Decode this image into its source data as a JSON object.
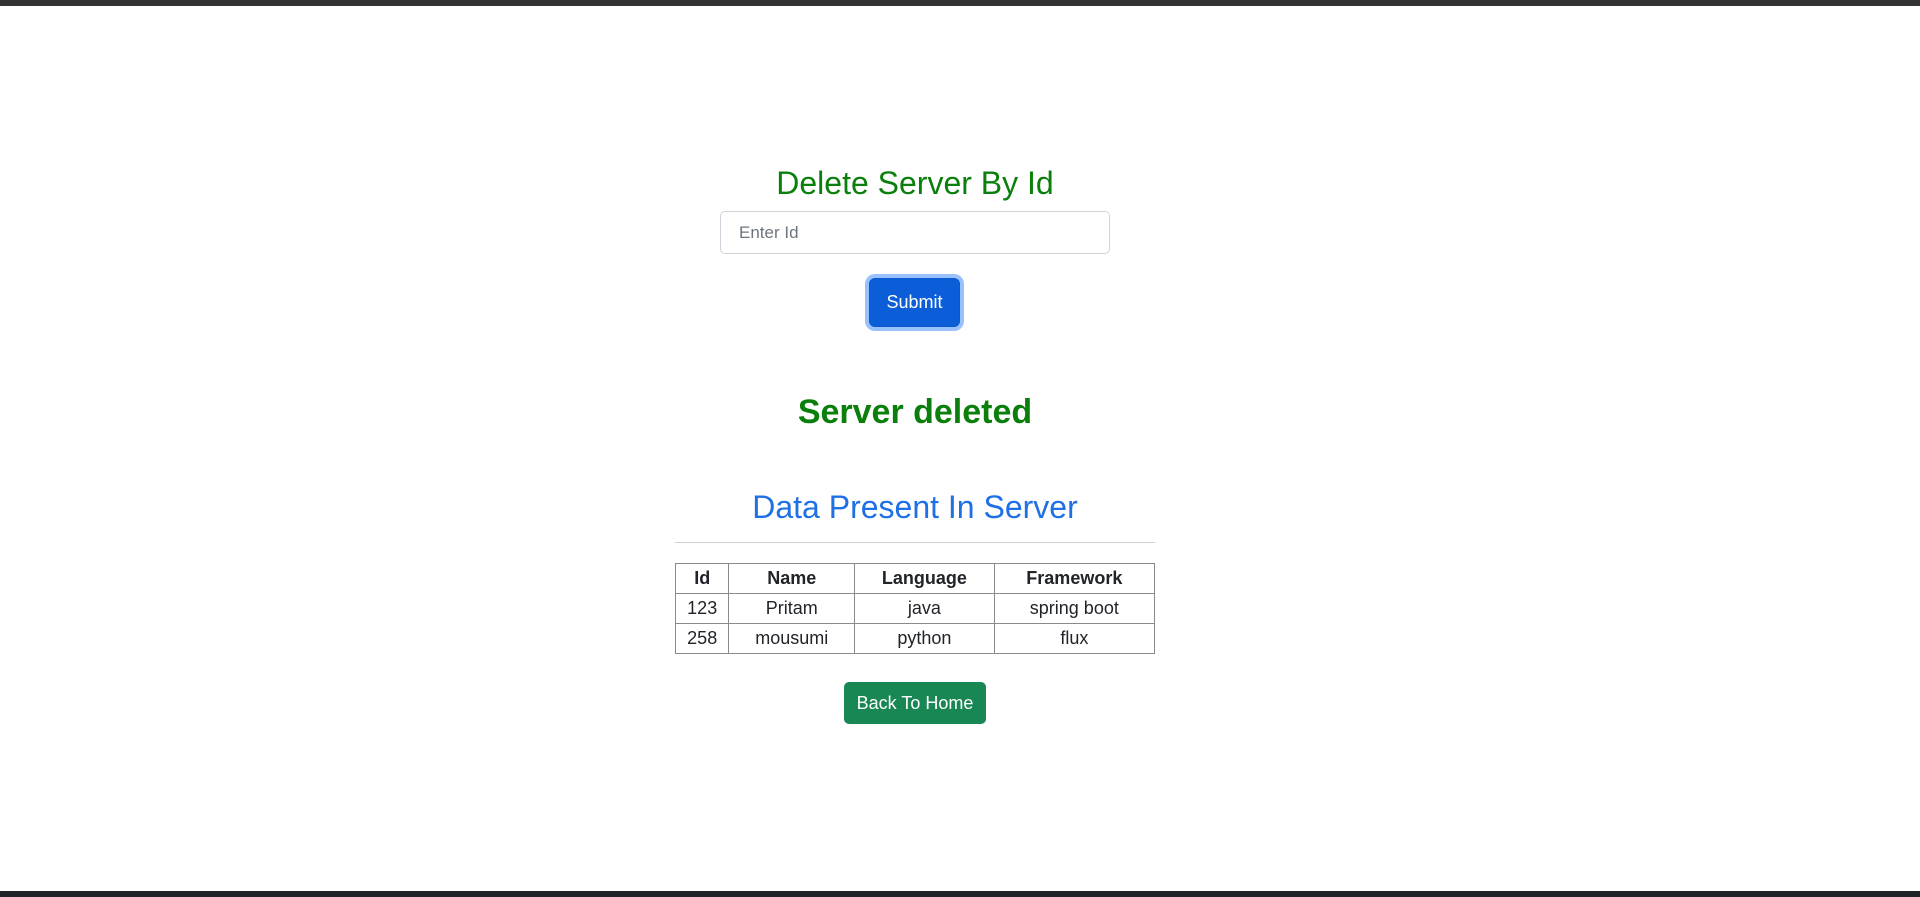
{
  "delete_form": {
    "heading": "Delete Server By Id",
    "id_input": {
      "value": "",
      "placeholder": "Enter Id"
    },
    "submit_label": "Submit"
  },
  "status": {
    "message": "Server deleted"
  },
  "data_section": {
    "title": "Data Present In Server",
    "columns": [
      "Id",
      "Name",
      "Language",
      "Framework"
    ],
    "rows": [
      [
        "123",
        "Pritam",
        "java",
        "spring boot"
      ],
      [
        "258",
        "mousumi",
        "python",
        "flux"
      ]
    ]
  },
  "navigation": {
    "back_home_label": "Back To Home"
  },
  "colors": {
    "heading_green": "#0b7f0b",
    "title_blue": "#1f6fe5",
    "primary_button": "#0b5ed7",
    "success_button": "#198754"
  }
}
